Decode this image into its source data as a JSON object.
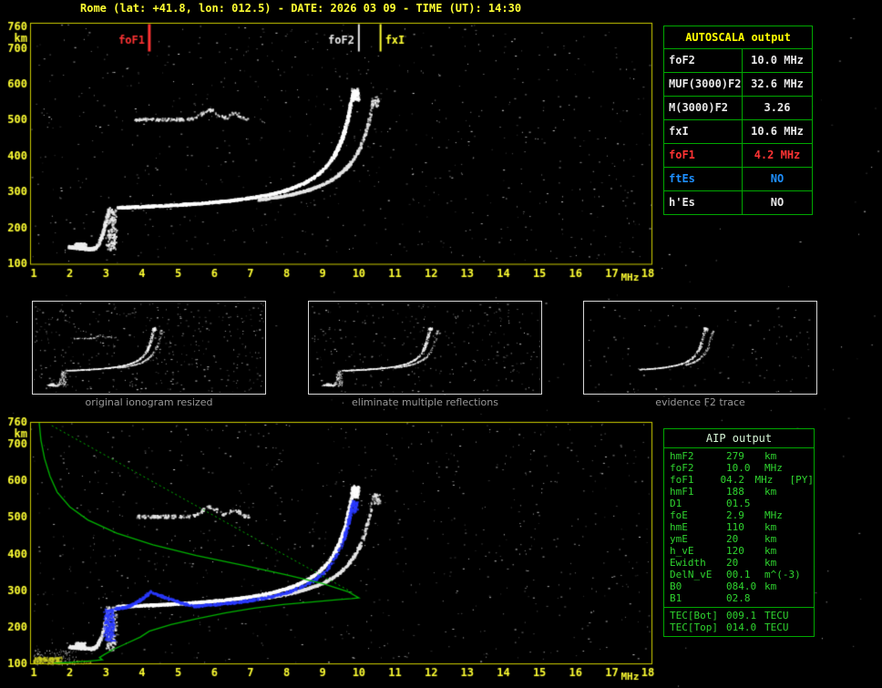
{
  "title": "Rome (lat: +41.8, lon: 012.5) - DATE: 2026 03 09 - TIME (UT): 14:30",
  "colors": {
    "accent_yellow": "#ffff33",
    "plot_border_yellow": "#cccc00",
    "panel_border_green": "#00a800",
    "text_white": "#e8e8e8",
    "alert_red": "#ff3333",
    "info_blue": "#1e8fff",
    "profile_green": "#00b400",
    "restored_trace_blue": "#2a3aff",
    "caption_gray": "#989898"
  },
  "top_plot": {
    "y_unit": "km",
    "x_unit": "MHz",
    "y_ticks": [
      760,
      700,
      600,
      500,
      400,
      300,
      200,
      100
    ],
    "x_ticks": [
      1,
      2,
      3,
      4,
      5,
      6,
      7,
      8,
      9,
      10,
      11,
      12,
      13,
      14,
      15,
      16,
      17,
      18
    ],
    "markers": [
      {
        "label": "foF1",
        "freq": 4.2,
        "color": "#ff3333"
      },
      {
        "label": "foF2",
        "freq": 10.0,
        "color": "#e8e8e8"
      },
      {
        "label": "fxI",
        "freq": 10.6,
        "color": "#ffff33"
      }
    ]
  },
  "bottom_plot": {
    "y_unit": "km",
    "x_unit": "MHz",
    "y_ticks": [
      760,
      700,
      600,
      500,
      400,
      300,
      200,
      100
    ],
    "x_ticks": [
      1,
      2,
      3,
      4,
      5,
      6,
      7,
      8,
      9,
      10,
      11,
      12,
      13,
      14,
      15,
      16,
      17,
      18
    ]
  },
  "autoscala_panel": {
    "title": "AUTOSCALA output",
    "rows": [
      {
        "name": "foF2",
        "value": "10.0 MHz",
        "color": "#e8e8e8"
      },
      {
        "name": "MUF(3000)F2",
        "value": "32.6 MHz",
        "color": "#e8e8e8"
      },
      {
        "name": "M(3000)F2",
        "value": "3.26",
        "color": "#e8e8e8"
      },
      {
        "name": "fxI",
        "value": "10.6 MHz",
        "color": "#e8e8e8"
      },
      {
        "name": "foF1",
        "value": "4.2 MHz",
        "color": "#ff3333"
      },
      {
        "name": "ftEs",
        "value": "NO",
        "color": "#1e8fff"
      },
      {
        "name": "h'Es",
        "value": "NO",
        "color": "#e8e8e8"
      }
    ]
  },
  "thumbnails": [
    {
      "caption": "original ionogram resized"
    },
    {
      "caption": "eliminate multiple reflections"
    },
    {
      "caption": "evidence F2 trace"
    }
  ],
  "aip_panel": {
    "title": "AIP output",
    "rows": [
      {
        "name": "hmF2",
        "value": "279",
        "unit": "km",
        "note": ""
      },
      {
        "name": "foF2",
        "value": "10.0",
        "unit": "MHz",
        "note": ""
      },
      {
        "name": "foF1",
        "value": "04.2",
        "unit": "MHz",
        "note": "[PY]"
      },
      {
        "name": "hmF1",
        "value": "188",
        "unit": "km",
        "note": ""
      },
      {
        "name": "D1",
        "value": "01.5",
        "unit": "",
        "note": ""
      },
      {
        "name": "foE",
        "value": "2.9",
        "unit": "MHz",
        "note": ""
      },
      {
        "name": "hmE",
        "value": "110",
        "unit": "km",
        "note": ""
      },
      {
        "name": "ymE",
        "value": "20",
        "unit": "km",
        "note": ""
      },
      {
        "name": "h_vE",
        "value": "120",
        "unit": "km",
        "note": ""
      },
      {
        "name": "Ewidth",
        "value": "20",
        "unit": "km",
        "note": ""
      },
      {
        "name": "DelN_vE",
        "value": "00.1",
        "unit": "m^(-3)",
        "note": ""
      },
      {
        "name": "B0",
        "value": "084.0",
        "unit": "km",
        "note": ""
      },
      {
        "name": "B1",
        "value": "02.8",
        "unit": "",
        "note": ""
      }
    ],
    "tec_rows": [
      {
        "name": "TEC[Bot]",
        "value": "009.1",
        "unit": "TECU"
      },
      {
        "name": "TEC[Top]",
        "value": "014.0",
        "unit": "TECU"
      }
    ]
  },
  "profile_params": {
    "foE_MHz": 2.9,
    "hmE_km": 110,
    "ymE_km": 20,
    "h_vE_km": 120,
    "foF1_MHz": 4.2,
    "hmF1_km": 188,
    "foF2_MHz": 10.0,
    "hmF2_km": 279,
    "fxI_MHz": 10.6,
    "MUF3000F2_MHz": 32.6,
    "M3000F2": 3.26,
    "B0_km": 84.0,
    "B1": 2.8,
    "TEC_bot_TECU": 9.1,
    "TEC_top_TECU": 14.0
  },
  "chart_data": [
    {
      "type": "scatter",
      "title": "Ionogram with autoscaled characteristics",
      "xlabel": "MHz",
      "ylabel": "km",
      "xlim": [
        1,
        18
      ],
      "ylim": [
        100,
        760
      ],
      "annotations": [
        {
          "label": "foF1",
          "x": 4.2
        },
        {
          "label": "foF2",
          "x": 10.0
        },
        {
          "label": "fxI",
          "x": 10.6
        }
      ],
      "series": [
        {
          "name": "E-region trace",
          "points": [
            [
              2.0,
              148
            ],
            [
              2.5,
              143
            ],
            [
              2.8,
              165
            ],
            [
              3.0,
              250
            ]
          ]
        },
        {
          "name": "F trace O-mode",
          "points": [
            [
              3.3,
              258
            ],
            [
              5.0,
              260
            ],
            [
              7.0,
              284
            ],
            [
              8.0,
              307
            ],
            [
              9.0,
              364
            ],
            [
              9.5,
              446
            ],
            [
              9.9,
              585
            ]
          ]
        },
        {
          "name": "F trace X-mode",
          "points": [
            [
              7.5,
              265
            ],
            [
              9.0,
              300
            ],
            [
              9.8,
              330
            ],
            [
              10.3,
              430
            ],
            [
              10.55,
              565
            ]
          ]
        },
        {
          "name": "second reflection",
          "points": [
            [
              3.8,
              503
            ],
            [
              5.0,
              504
            ],
            [
              5.85,
              529
            ],
            [
              6.5,
              512
            ],
            [
              6.95,
              503
            ]
          ]
        }
      ]
    },
    {
      "type": "scatter",
      "title": "Ionogram with restored trace and electron density profile",
      "xlabel": "MHz",
      "ylabel": "km",
      "xlim": [
        1,
        18
      ],
      "ylim": [
        100,
        760
      ],
      "series": [
        {
          "name": "restored trace (blue)",
          "points": [
            [
              3.0,
              165
            ],
            [
              3.1,
              250
            ],
            [
              3.6,
              257
            ],
            [
              4.2,
              300
            ],
            [
              5.0,
              262
            ],
            [
              6.0,
              270
            ],
            [
              8.0,
              300
            ],
            [
              9.5,
              440
            ],
            [
              9.9,
              540
            ]
          ]
        },
        {
          "name": "electron density profile (green)",
          "points": [
            [
              1.55,
              100
            ],
            [
              2.2,
              104
            ],
            [
              2.7,
              108
            ],
            [
              2.9,
              110
            ],
            [
              2.82,
              116
            ],
            [
              2.95,
              124
            ],
            [
              3.2,
              138
            ],
            [
              3.6,
              156
            ],
            [
              3.95,
              172
            ],
            [
              4.2,
              188
            ],
            [
              4.8,
              206
            ],
            [
              5.5,
              222
            ],
            [
              6.3,
              238
            ],
            [
              7.1,
              251
            ],
            [
              7.9,
              261
            ],
            [
              8.7,
              268
            ],
            [
              9.4,
              274
            ],
            [
              9.8,
              277
            ],
            [
              10.0,
              279
            ],
            [
              9.7,
              296
            ],
            [
              9.0,
              318
            ],
            [
              8.0,
              342
            ],
            [
              6.8,
              368
            ],
            [
              5.5,
              395
            ],
            [
              4.3,
              424
            ],
            [
              3.3,
              456
            ],
            [
              2.5,
              492
            ],
            [
              2.0,
              528
            ],
            [
              1.65,
              568
            ],
            [
              1.45,
              612
            ],
            [
              1.3,
              660
            ],
            [
              1.2,
              710
            ],
            [
              1.15,
              760
            ]
          ]
        },
        {
          "name": "topside guide (dotted green)",
          "points": [
            [
              1.5,
              750
            ],
            [
              9.85,
              292
            ]
          ]
        }
      ]
    }
  ]
}
